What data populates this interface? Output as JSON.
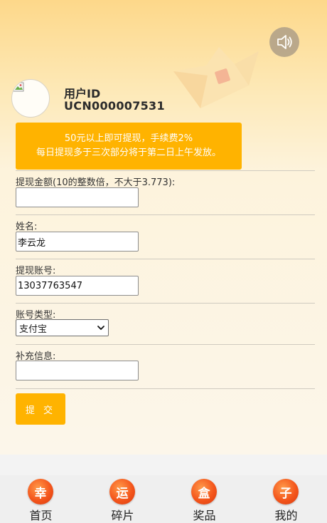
{
  "user": {
    "label": "用户ID",
    "id": "UCN000007531"
  },
  "notice": {
    "line1": "50元以上即可提现，手续费2%",
    "line2": "每日提现多于三次部分将于第二日上午发放。"
  },
  "form": {
    "amount": {
      "label": "提现金额(10的整数倍，不大于3.773):",
      "value": ""
    },
    "name": {
      "label": "姓名:",
      "value": "李云龙"
    },
    "account": {
      "label": "提现账号:",
      "value": "13037763547"
    },
    "account_type": {
      "label": "账号类型:",
      "selected": "支付宝"
    },
    "extra": {
      "label": "补充信息:",
      "value": ""
    },
    "submit_label": "提 交"
  },
  "tabs": [
    {
      "badge": "幸",
      "label": "首页"
    },
    {
      "badge": "运",
      "label": "碎片"
    },
    {
      "badge": "盒",
      "label": "奖品"
    },
    {
      "badge": "子",
      "label": "我的"
    }
  ],
  "colors": {
    "accent": "#ffb300",
    "badge": "#f4561c"
  },
  "icons": {
    "sound": "speaker-icon",
    "dropdown": "chevron-down-icon"
  }
}
